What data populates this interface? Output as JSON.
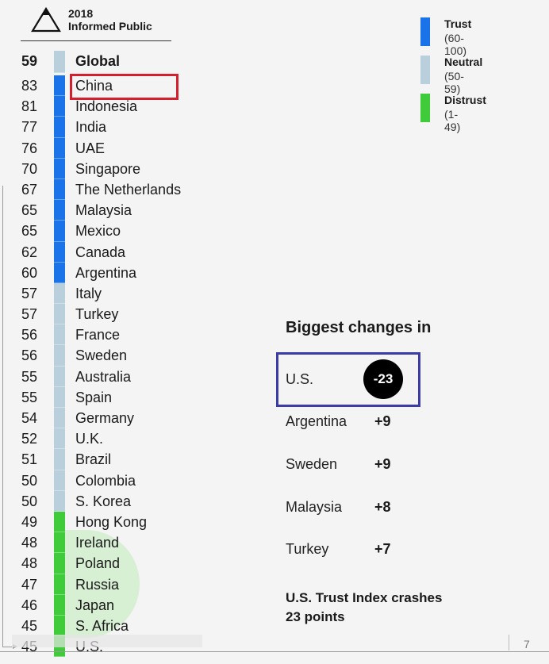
{
  "header": {
    "year": "2018",
    "audience": "Informed Public",
    "logo_icon": "mountain-triangle-icon"
  },
  "legend": [
    {
      "label": "Trust",
      "range": "(60-100)",
      "color": "#1a73e8"
    },
    {
      "label": "Neutral",
      "range": "(50-59)",
      "color": "#b9cfdb"
    },
    {
      "label": "Distrust",
      "range": "(1-49)",
      "color": "#3fcb3a"
    }
  ],
  "chart_data": {
    "type": "table",
    "title": "2018 Informed Public Trust Index",
    "categories": [
      "Global",
      "China",
      "Indonesia",
      "India",
      "UAE",
      "Singapore",
      "The Netherlands",
      "Malaysia",
      "Mexico",
      "Canada",
      "Argentina",
      "Italy",
      "Turkey",
      "France",
      "Sweden",
      "Australia",
      "Spain",
      "Germany",
      "U.K.",
      "Brazil",
      "Colombia",
      "S. Korea",
      "Hong Kong",
      "Ireland",
      "Poland",
      "Russia",
      "Japan",
      "S. Africa",
      "U.S."
    ],
    "values": [
      59,
      83,
      81,
      77,
      76,
      70,
      67,
      65,
      65,
      62,
      60,
      57,
      57,
      56,
      56,
      55,
      55,
      54,
      52,
      51,
      50,
      50,
      49,
      48,
      48,
      47,
      46,
      45,
      45
    ],
    "thresholds": {
      "trust_min": 60,
      "neutral_min": 50
    },
    "highlighted": [
      "China"
    ],
    "changes": {
      "title": "Biggest changes in",
      "items": [
        {
          "country": "U.S.",
          "change": "-23",
          "highlighted": true
        },
        {
          "country": "Argentina",
          "change": "+9"
        },
        {
          "country": "Sweden",
          "change": "+9"
        },
        {
          "country": "Malaysia",
          "change": "+8"
        },
        {
          "country": "Turkey",
          "change": "+7"
        }
      ]
    }
  },
  "note": {
    "line1": "U.S. Trust Index crashes",
    "line2": "23 points"
  },
  "page_number": "7"
}
